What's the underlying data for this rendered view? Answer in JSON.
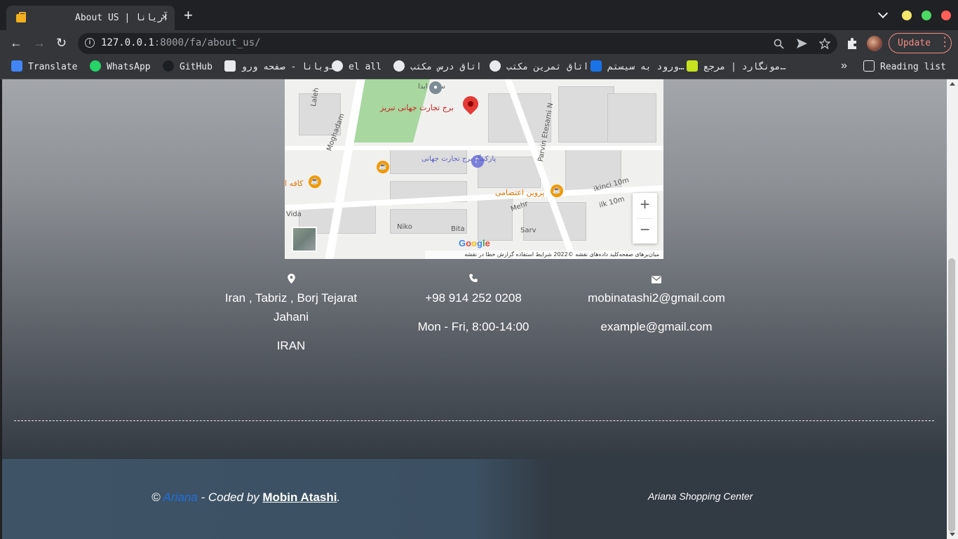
{
  "browser": {
    "tab_title": "About US | آریانا",
    "tab_close": "×",
    "new_tab": "+",
    "url_host": "127.0.0.1",
    "url_rest": ":8000/fa/about_us/",
    "update_label": "Update",
    "bookmarks_more": "»",
    "bookmarks": [
      {
        "label": "Translate",
        "icon": "google-translate-icon",
        "color": "#4285f4"
      },
      {
        "label": "WhatsApp",
        "icon": "whatsapp-icon",
        "color": "#25d366"
      },
      {
        "label": "GitHub",
        "icon": "github-icon",
        "color": "#202124"
      },
      {
        "label": "وبانا - صفحه ورو…",
        "icon": "page-icon",
        "color": "#e8eaed"
      },
      {
        "label": "el all",
        "icon": "account-icon",
        "color": "#e8eaed"
      },
      {
        "label": "اتاق درس مکتب",
        "icon": "account-icon",
        "color": "#e8eaed"
      },
      {
        "label": "اتاق تمرین مکتب",
        "icon": "account-icon",
        "color": "#e8eaed"
      },
      {
        "label": "ورود به سیستم…",
        "icon": "site-icon",
        "color": "#1a73e8"
      },
      {
        "label": "مونگارد | مرجع…",
        "icon": "site-icon",
        "color": "#c6e21f"
      }
    ],
    "reading_list": "Reading list"
  },
  "map": {
    "pin_label": "برج تجارت جهانی تبریز",
    "parking_label": "پارکینگ برج تجارت جهانی",
    "cafe_label": "پروین اعتصامی",
    "cafe_left": "کافه ا",
    "hall_label": "سالن ایدا",
    "streets": [
      "Laleh",
      "Moghadam",
      "Parvin Etesami N",
      "Niko",
      "Bita",
      "Sarv",
      "Mehr",
      "ikinci 10m",
      "ilk 10m",
      "Vida"
    ],
    "zoom_in": "+",
    "zoom_out": "−",
    "google": "Google",
    "attribution": "میان‌برهای صفحه‌کلید   داده‌های نقشه ©2022   شرایط استفاده   گزارش خطا در نقشه"
  },
  "contact": {
    "address_line1": "Iran , Tabriz , Borj Tejarat",
    "address_line2": "Jahani",
    "country": "IRAN",
    "phone": "+98 914 252 0208",
    "hours": "Mon - Fri, 8:00-14:00",
    "email1": "mobinatashi2@gmail.com",
    "email2": "example@gmail.com"
  },
  "footer": {
    "copyright_symbol": "©",
    "brand": "Ariana",
    "coded_by": " - Coded by ",
    "author": "Mobin Atashi",
    "period": ".",
    "shop_name": "Ariana Shopping Center"
  }
}
